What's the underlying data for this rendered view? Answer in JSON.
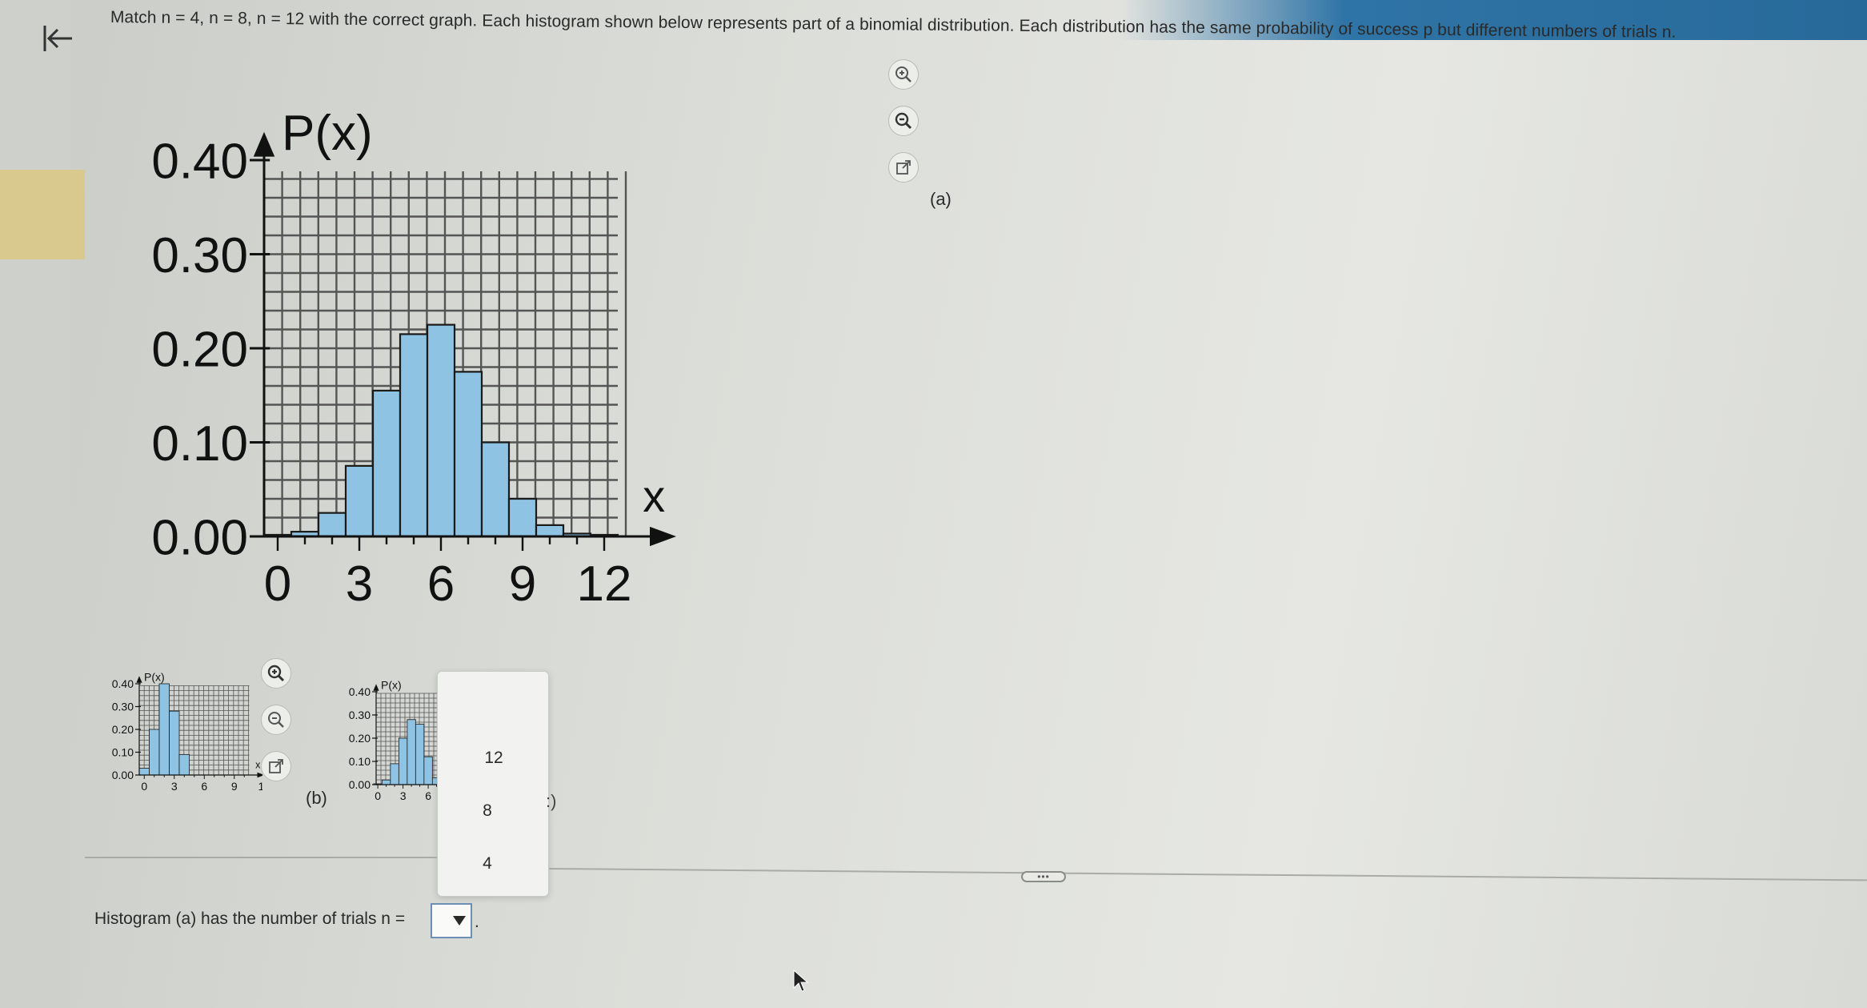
{
  "header": {
    "back_icon": "back-to-start-icon",
    "question": "Match n = 4, n = 8, n = 12 with the correct graph. Each histogram shown below represents part of a binomial distribution. Each distribution has the same probability of success p but different numbers of trials n."
  },
  "colors": {
    "bar_fill": "#8ec3e3",
    "bar_stroke": "#1a1a1a",
    "grid": "#555555",
    "accent": "#2f74a6"
  },
  "toolbar_a": {
    "icons": [
      "zoom-in-icon",
      "zoom-out-icon",
      "open-new-window-icon"
    ]
  },
  "toolbar_b": {
    "icons": [
      "zoom-in-icon",
      "zoom-out-icon",
      "open-new-window-icon"
    ]
  },
  "labels": {
    "a": "(a)",
    "b": "(b)"
  },
  "chart_data": [
    {
      "name": "histogram-a",
      "type": "bar",
      "ylabel": "P(x)",
      "xlabel": "x",
      "x": [
        0,
        1,
        2,
        3,
        4,
        5,
        6,
        7,
        8,
        9,
        10,
        11,
        12
      ],
      "values": [
        0.001,
        0.005,
        0.025,
        0.075,
        0.155,
        0.215,
        0.225,
        0.175,
        0.1,
        0.04,
        0.012,
        0.003,
        0.0005
      ],
      "ylim": [
        0,
        0.4
      ],
      "yticks": [
        "0.00",
        "0.10",
        "0.20",
        "0.30",
        "0.40"
      ],
      "xticks": [
        "0",
        "3",
        "6",
        "9",
        "12"
      ],
      "grid": true
    },
    {
      "name": "histogram-c-thumb",
      "type": "bar",
      "ylabel": "P(x)",
      "xlabel": "x",
      "x": [
        0,
        1,
        2,
        3,
        4
      ],
      "values": [
        0.03,
        0.2,
        0.4,
        0.28,
        0.09
      ],
      "ylim": [
        0,
        0.4
      ],
      "yticks": [
        "0.00",
        "0.10",
        "0.20",
        "0.30",
        "0.40"
      ],
      "xticks": [
        "0",
        "3",
        "6",
        "9",
        "12"
      ],
      "grid": true
    },
    {
      "name": "histogram-b-thumb",
      "type": "bar",
      "ylabel": "P(x)",
      "x": [
        0,
        1,
        2,
        3,
        4,
        5,
        6,
        7,
        8
      ],
      "values": [
        0.002,
        0.02,
        0.09,
        0.2,
        0.28,
        0.26,
        0.12,
        0.03,
        0.005
      ],
      "ylim": [
        0,
        0.4
      ],
      "yticks": [
        "0.00",
        "0.10",
        "0.20",
        "0.30",
        "0.40"
      ],
      "xticks": [
        "0",
        "3",
        "6"
      ],
      "grid": true
    }
  ],
  "dropdown_options": [
    "12",
    "8",
    "4"
  ],
  "popup_tail": ":)",
  "answer": {
    "prefix": "Histogram (a) has the number of trials n =",
    "suffix": ".",
    "selected": ""
  }
}
